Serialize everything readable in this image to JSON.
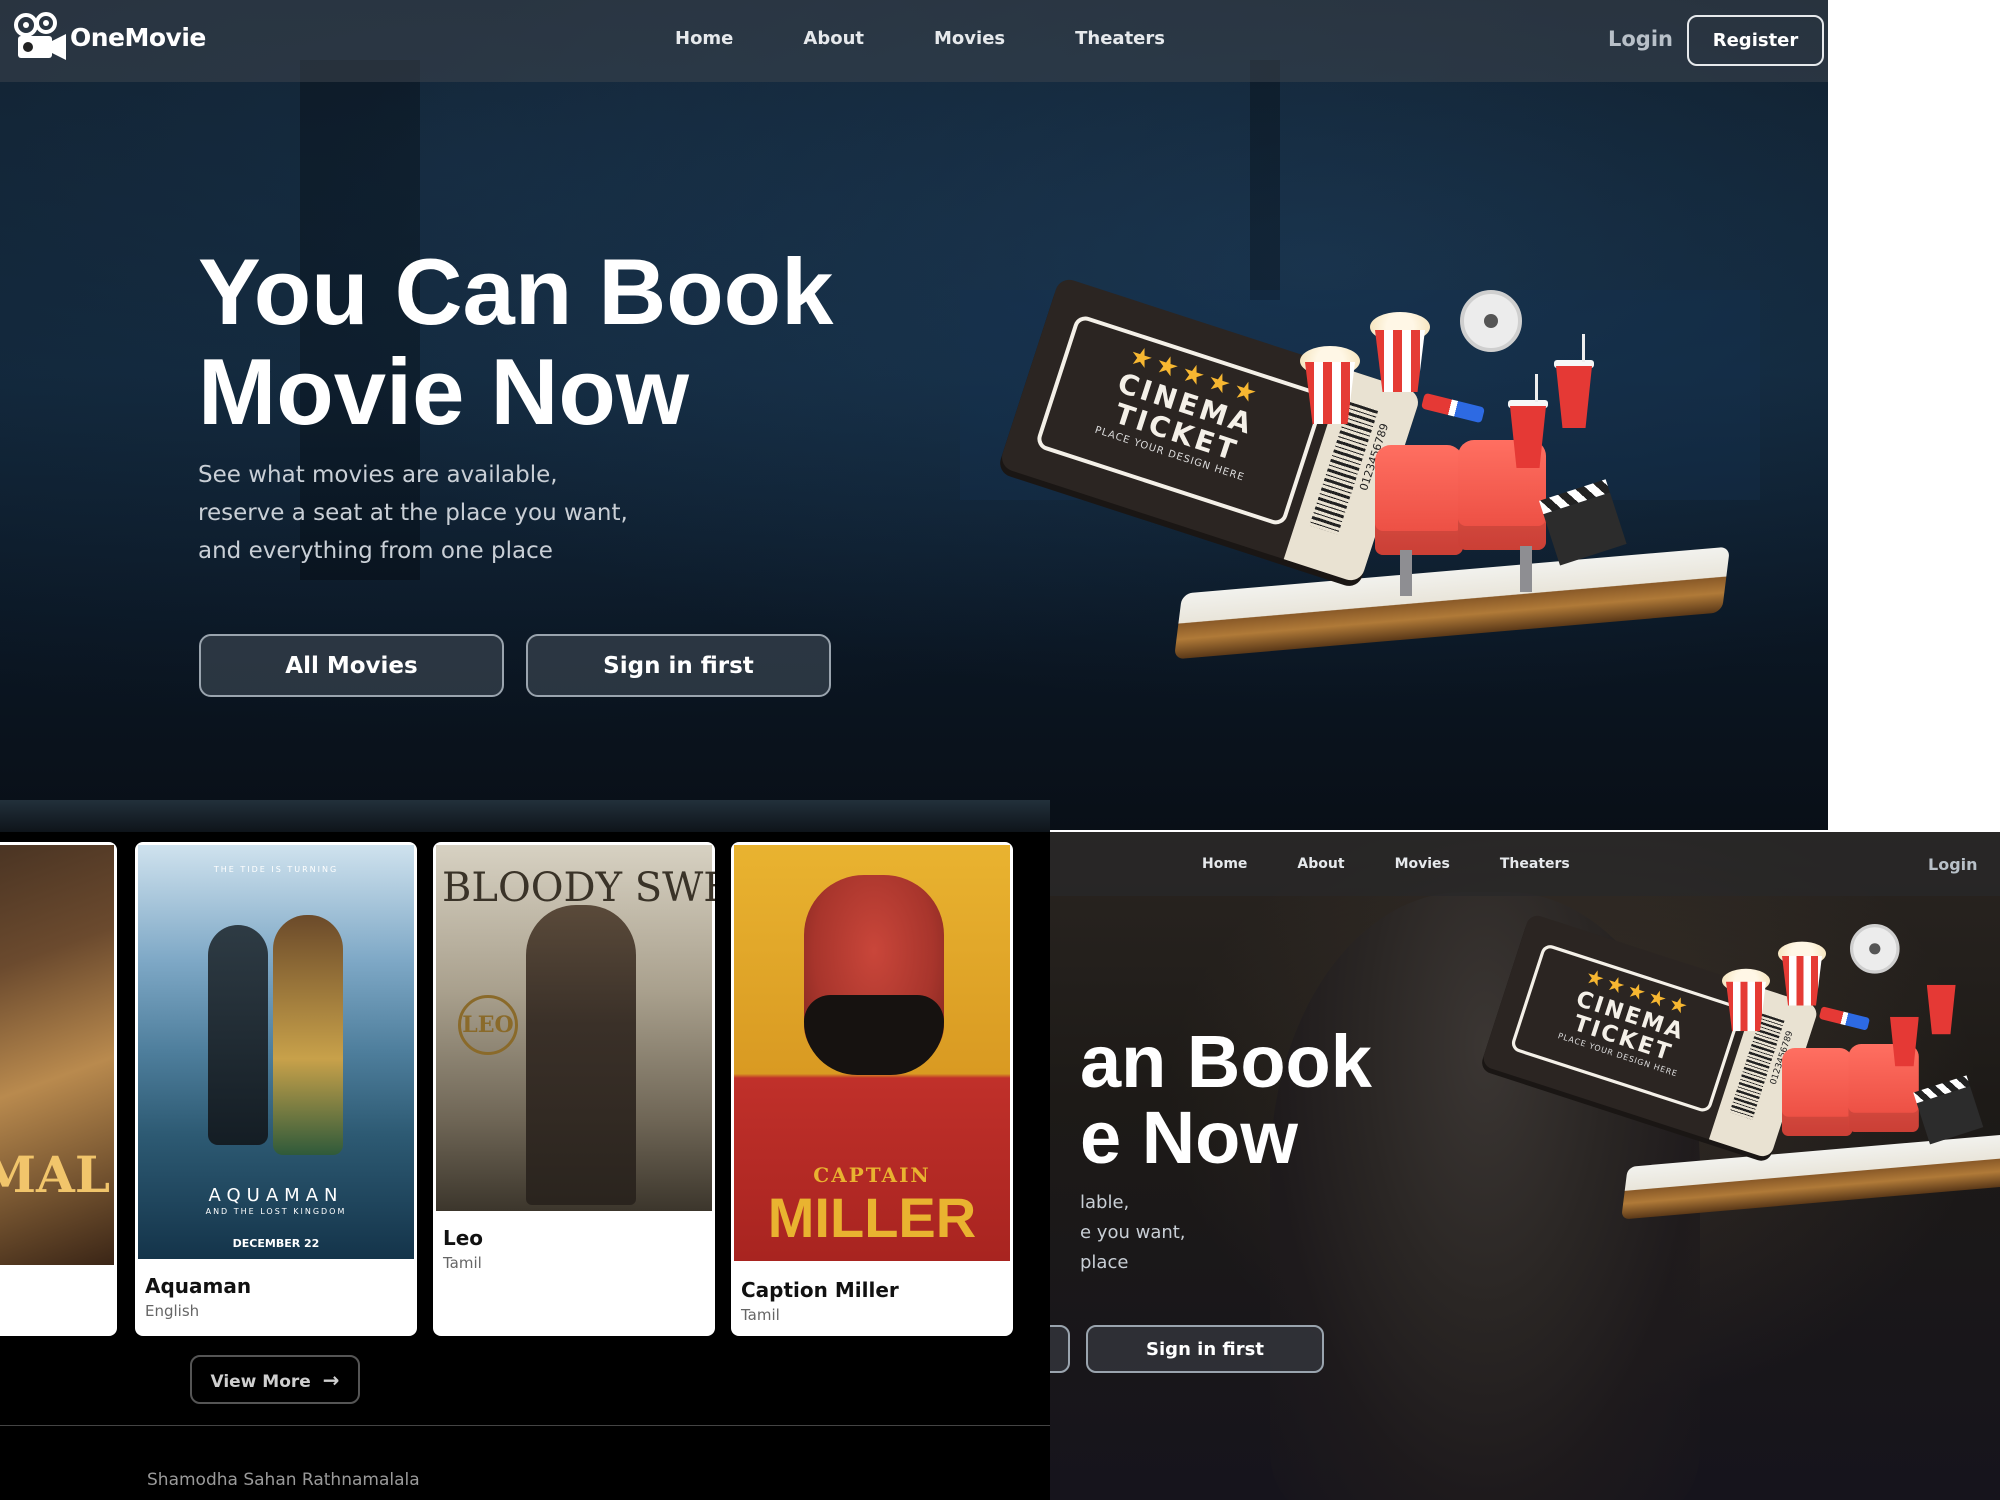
{
  "brand": {
    "name": "OneMovie",
    "logo_icon": "film-camera-icon"
  },
  "nav": {
    "links": [
      "Home",
      "About",
      "Movies",
      "Theaters"
    ],
    "login": "Login",
    "register": "Register"
  },
  "hero": {
    "title_line1": "You Can Book",
    "title_line2": "Movie Now",
    "subtitle_line1": "See what movies are available,",
    "subtitle_line2": "reserve a seat at the place you want,",
    "subtitle_line3": "and everything from one place",
    "all_movies_button": "All Movies",
    "sign_in_button": "Sign in first"
  },
  "ticket": {
    "title_line1": "CINEMA",
    "title_line2": "TICKET",
    "small_text": "PLACE YOUR DESIGN HERE",
    "barcode_number": "0123456789"
  },
  "movies": [
    {
      "title": "Aquaman",
      "language": "English",
      "poster_text": "AQUAMAN",
      "poster_subtext": "AND THE LOST KINGDOM",
      "poster_date": "DECEMBER 22",
      "poster_tag": "THE TIDE IS TURNING"
    },
    {
      "title": "Leo",
      "language": "Tamil",
      "poster_text": "BLOODY SWEET",
      "poster_subtext": "LEO"
    },
    {
      "title": "Caption Miller",
      "language": "Tamil",
      "poster_text": "MILLER",
      "poster_subtext": "CAPTAIN"
    }
  ],
  "partial_poster_text": "MAL",
  "view_more": "View More",
  "footer": {
    "name": "Shamodha Sahan Rathnamalala"
  },
  "hero_partial": {
    "title_line1": "an Book",
    "title_line2": "e Now",
    "subtitle_line1": "lable,",
    "subtitle_line2": "e you want,",
    "subtitle_line3": "place"
  },
  "colors": {
    "accent_red": "#e53935",
    "star_gold": "#f7b731",
    "text_light": "#e6e9ec"
  }
}
